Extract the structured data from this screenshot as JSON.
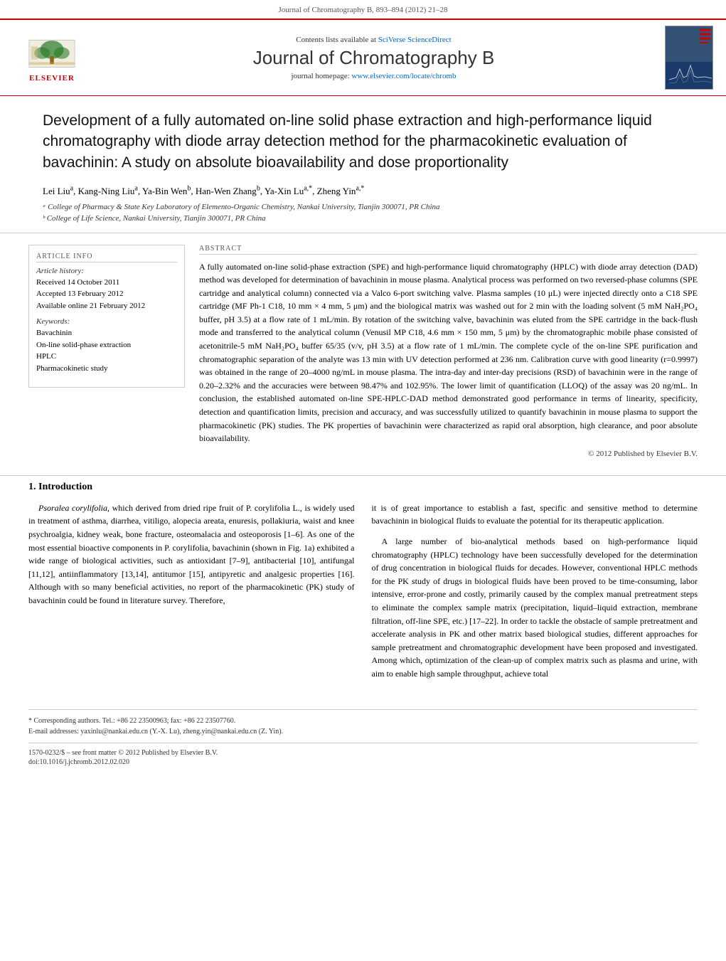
{
  "header": {
    "journal_ref": "Journal of Chromatography B, 893–894 (2012) 21–28",
    "contents_text": "Contents lists available at",
    "sciverse_link": "SciVerse ScienceDirect",
    "journal_title": "Journal of Chromatography B",
    "homepage_text": "journal homepage:",
    "homepage_link": "www.elsevier.com/locate/chromb",
    "elsevier_label": "ELSEVIER"
  },
  "article": {
    "title": "Development of a fully automated on-line solid phase extraction and high-performance liquid chromatography with diode array detection method for the pharmacokinetic evaluation of bavachinin: A study on absolute bioavailability and dose proportionality",
    "authors": "Lei Liuᵃ, Kang-Ning Liuᵃ, Ya-Bin Wenᵇ, Han-Wen Zhangᵇ, Ya-Xin Luᵃ,*, Zheng Yinᵃ,*",
    "affiliation_a": "ᵃ College of Pharmacy & State Key Laboratory of Elemento-Organic Chemistry, Nankai University, Tianjin 300071, PR China",
    "affiliation_b": "ᵇ College of Life Science, Nankai University, Tianjin 300071, PR China"
  },
  "article_info": {
    "section_label": "ARTICLE INFO",
    "history_label": "Article history:",
    "received": "Received 14 October 2011",
    "accepted": "Accepted 13 February 2012",
    "available": "Available online 21 February 2012",
    "keywords_label": "Keywords:",
    "keyword1": "Bavachinin",
    "keyword2": "On-line solid-phase extraction",
    "keyword3": "HPLC",
    "keyword4": "Pharmacokinetic study"
  },
  "abstract": {
    "label": "ABSTRACT",
    "text": "A fully automated on-line solid-phase extraction (SPE) and high-performance liquid chromatography (HPLC) with diode array detection (DAD) method was developed for determination of bavachinin in mouse plasma. Analytical process was performed on two reversed-phase columns (SPE cartridge and analytical column) connected via a Valco 6-port switching valve. Plasma samples (10 μL) were injected directly onto a C18 SPE cartridge (MF Ph-1 C18, 10 mm × 4 mm, 5 μm) and the biological matrix was washed out for 2 min with the loading solvent (5 mM NaH₂PO₄ buffer, pH 3.5) at a flow rate of 1 mL/min. By rotation of the switching valve, bavachinin was eluted from the SPE cartridge in the back-flush mode and transferred to the analytical column (Venusil MP C18, 4.6 mm × 150 mm, 5 μm) by the chromatographic mobile phase consisted of acetonitrile-5 mM NaH₂PO₄ buffer 65/35 (v/v, pH 3.5) at a flow rate of 1 mL/min. The complete cycle of the on-line SPE purification and chromatographic separation of the analyte was 13 min with UV detection performed at 236 nm. Calibration curve with good linearity (r=0.9997) was obtained in the range of 20–4000 ng/mL in mouse plasma. The intra-day and inter-day precisions (RSD) of bavachinin were in the range of 0.20–2.32% and the accuracies were between 98.47% and 102.95%. The lower limit of quantification (LLOQ) of the assay was 20 ng/mL. In conclusion, the established automated on-line SPE-HPLC-DAD method demonstrated good performance in terms of linearity, specificity, detection and quantification limits, precision and accuracy, and was successfully utilized to quantify bavachinin in mouse plasma to support the pharmacokinetic (PK) studies. The PK properties of bavachinin were characterized as rapid oral absorption, high clearance, and poor absolute bioavailability.",
    "copyright": "© 2012 Published by Elsevier B.V."
  },
  "introduction": {
    "section_number": "1.",
    "section_title": "Introduction",
    "left_para1": "Psoralea corylifolia, which derived from dried ripe fruit of P. corylifolia L., is widely used in treatment of asthma, diarrhea, vitiligo, alopecia areata, enuresis, pollakiuria, waist and knee psychroalgia, kidney weak, bone fracture, osteomalacia and osteoporosis [1–6]. As one of the most essential bioactive components in P. corylifolia, bavachinin (shown in Fig. 1a) exhibited a wide range of biological activities, such as antioxidant [7–9], antibacterial [10], antifungal [11,12], antiinflammatory [13,14], antitumor [15], antipyretic and analgesic properties [16]. Although with so many beneficial activities, no report of the pharmacokinetic (PK) study of bavachinin could be found in literature survey. Therefore,",
    "right_para1": "it is of great importance to establish a fast, specific and sensitive method to determine bavachinin in biological fluids to evaluate the potential for its therapeutic application.",
    "right_para2": "A large number of bio-analytical methods based on high-performance liquid chromatography (HPLC) technology have been successfully developed for the determination of drug concentration in biological fluids for decades. However, conventional HPLC methods for the PK study of drugs in biological fluids have been proved to be time-consuming, labor intensive, error-prone and costly, primarily caused by the complex manual pretreatment steps to eliminate the complex sample matrix (precipitation, liquid–liquid extraction, membrane filtration, off-line SPE, etc.) [17–22]. In order to tackle the obstacle of sample pretreatment and accelerate analysis in PK and other matrix based biological studies, different approaches for sample pretreatment and chromatographic development have been proposed and investigated. Among which, optimization of the clean-up of complex matrix such as plasma and urine, with aim to enable high sample throughput, achieve total"
  },
  "footer": {
    "footnote_star": "* Corresponding authors. Tel.: +86 22 23500963; fax: +86 22 23507760.",
    "email_line": "E-mail addresses: yaxinlu@nankai.edu.cn (Y.-X. Lu), zheng.yin@nankai.edu.cn (Z. Yin).",
    "issn_line": "1570-0232/$ – see front matter © 2012 Published by Elsevier B.V.",
    "doi_line": "doi:10.1016/j.jchromb.2012.02.020"
  }
}
